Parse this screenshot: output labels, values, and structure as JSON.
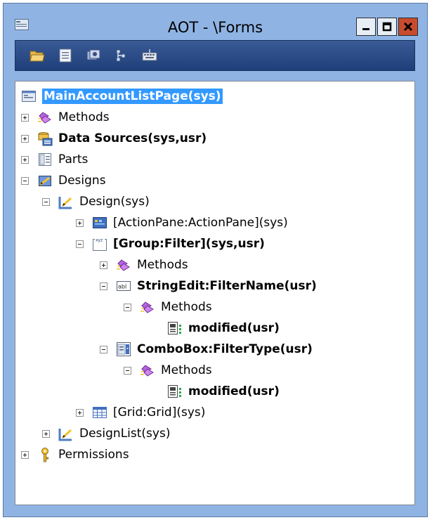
{
  "window": {
    "title": "AOT - \\Forms"
  },
  "toolbar": {
    "buttons": [
      {
        "icon": "open-folder-icon"
      },
      {
        "icon": "properties-icon"
      },
      {
        "icon": "compile-icon"
      },
      {
        "icon": "find-icon"
      },
      {
        "icon": "keyboard-icon"
      }
    ]
  },
  "tree": {
    "nodes": [
      {
        "label": "MainAccountListPage(sys)",
        "icon": "form-icon",
        "expander": "none",
        "bold": true,
        "selected": true
      },
      {
        "label": "Methods",
        "icon": "methods-icon",
        "expander": "plus",
        "bold": false
      },
      {
        "label": "Data Sources(sys,usr)",
        "icon": "data-sources-icon",
        "expander": "plus",
        "bold": true
      },
      {
        "label": "Parts",
        "icon": "parts-icon",
        "expander": "plus",
        "bold": false
      },
      {
        "label": "Designs",
        "icon": "designs-icon",
        "expander": "minus",
        "bold": false
      },
      {
        "label": "Design(sys)",
        "icon": "design-icon",
        "expander": "minus",
        "bold": false
      },
      {
        "label": "[ActionPane:ActionPane](sys)",
        "icon": "actionpane-icon",
        "expander": "plus",
        "bold": false
      },
      {
        "label": "[Group:Filter](sys,usr)",
        "icon": "group-icon",
        "expander": "minus",
        "bold": true
      },
      {
        "label": "Methods",
        "icon": "methods-icon",
        "expander": "plus",
        "bold": false
      },
      {
        "label": "StringEdit:FilterName(usr)",
        "icon": "stringedit-icon",
        "expander": "minus",
        "bold": true
      },
      {
        "label": "Methods",
        "icon": "methods-icon",
        "expander": "minus",
        "bold": false
      },
      {
        "label": "modified(usr)",
        "icon": "method-icon",
        "expander": "none",
        "bold": true
      },
      {
        "label": "ComboBox:FilterType(usr)",
        "icon": "combobox-icon",
        "expander": "minus",
        "bold": true
      },
      {
        "label": "Methods",
        "icon": "methods-icon",
        "expander": "minus",
        "bold": false
      },
      {
        "label": "modified(usr)",
        "icon": "method-icon",
        "expander": "none",
        "bold": true
      },
      {
        "label": "[Grid:Grid](sys)",
        "icon": "grid-icon",
        "expander": "plus",
        "bold": false
      },
      {
        "label": "DesignList(sys)",
        "icon": "design-icon",
        "expander": "plus",
        "bold": false
      },
      {
        "label": "Permissions",
        "icon": "permissions-icon",
        "expander": "plus",
        "bold": false
      }
    ]
  }
}
